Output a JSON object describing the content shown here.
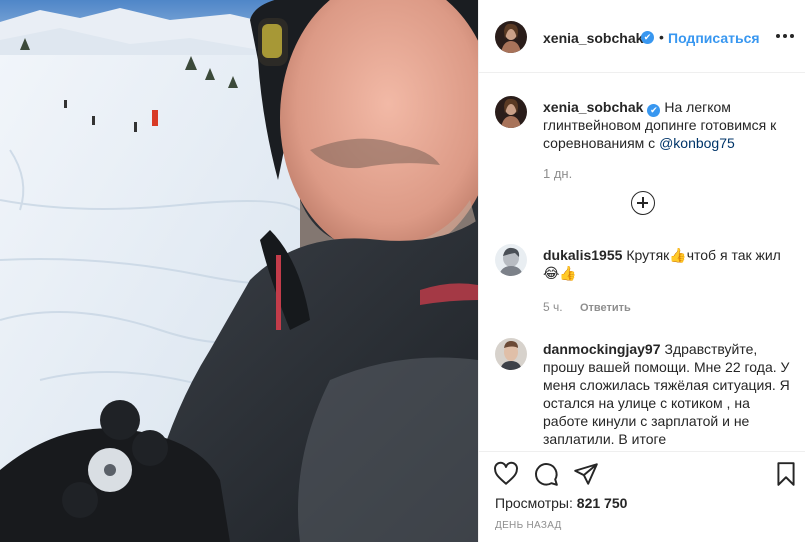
{
  "post": {
    "author": "xenia_sobchak",
    "verified_mark": "✔",
    "separator": "•",
    "follow_label": "Подписаться",
    "more_icon": "ellipsis-icon"
  },
  "caption": {
    "author": "xenia_sobchak",
    "text": "На легком глинтвейновом допинге готовимся к соревнованиям с ",
    "mention": "@konbog75",
    "time": "1 дн."
  },
  "comments": [
    {
      "author": "dukalis1955",
      "text": "Крутяк👍чтоб я так жил😂👍",
      "time": "5 ч.",
      "reply_label": "Ответить"
    },
    {
      "author": "danmockingjay97",
      "text": "Здравствуйте, прошу вашей помощи. Мне 22 года. У меня сложилась тяжёлая ситуация. Я остался на улице с котиком , на работе кинули с зарплатой и не заплатили. В итоге"
    }
  ],
  "load_more_icon": "plus-circle-icon",
  "actions": {
    "like_icon": "heart-icon",
    "comment_icon": "comment-icon",
    "share_icon": "paper-plane-icon",
    "save_icon": "bookmark-icon"
  },
  "stats": {
    "views_label": "Просмотры:",
    "views_value": "821 750",
    "posted_ago": "ДЕНЬ НАЗАД"
  }
}
